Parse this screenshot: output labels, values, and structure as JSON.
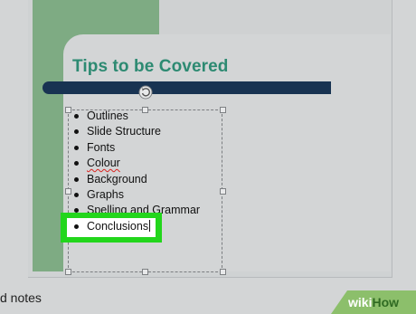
{
  "slide": {
    "title": "Tips to be Covered",
    "bullets": [
      "Outlines",
      "Slide Structure",
      "Fonts",
      "Colour",
      "Background",
      "Graphs",
      "Spelling and Grammar"
    ],
    "highlighted_bullet": "Conclusions",
    "misspelled_items": [
      "Colour"
    ]
  },
  "notes_pane": {
    "text": "d notes"
  },
  "watermark": {
    "part1": "wiki",
    "part2": "How"
  },
  "colors": {
    "title": "#2d8a72",
    "title_bar": "#183352",
    "green_band": "#7eab83",
    "highlight": "#22d61c",
    "spellcheck_underline": "#d9231f"
  },
  "icons": {
    "rotate_handle": "rotate-icon"
  }
}
